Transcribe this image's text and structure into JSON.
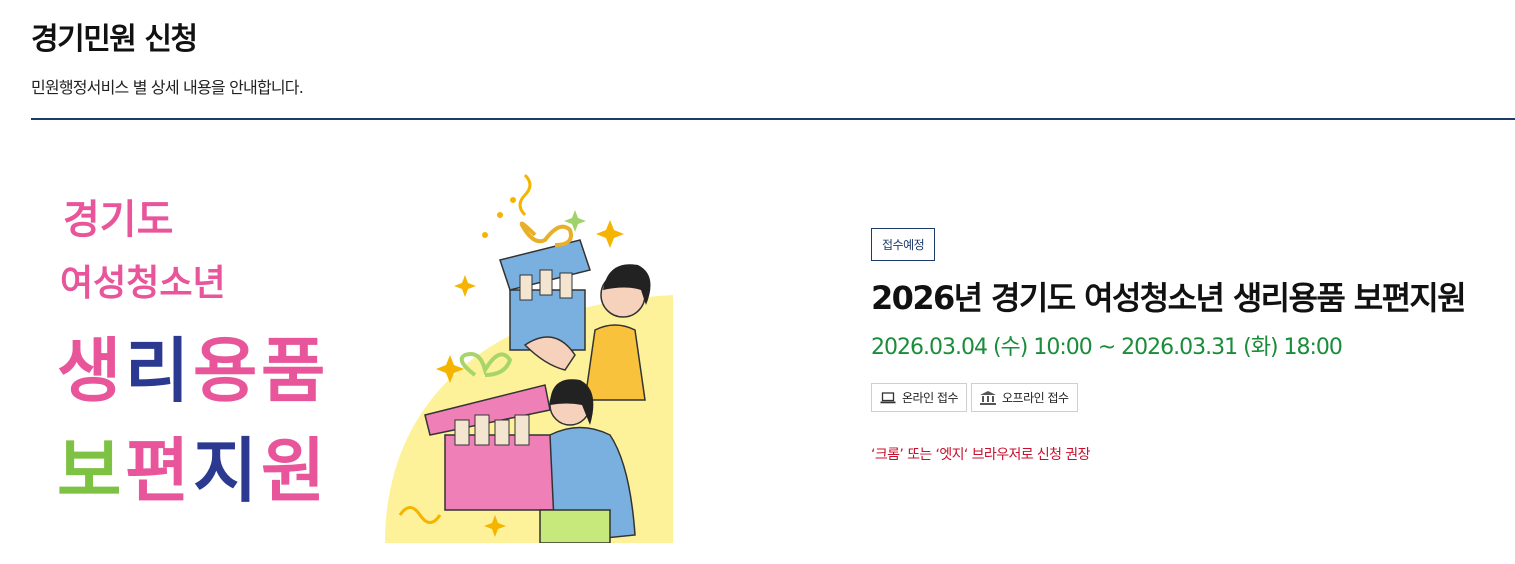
{
  "header": {
    "title": "경기민원 신청",
    "description": "민원행정서비스 별 상세 내용을 안내합니다."
  },
  "poster": {
    "line1": "경기도",
    "line2": "여성청소년",
    "line3": [
      "생",
      "리",
      "용",
      "품"
    ],
    "line4": [
      "보",
      "편",
      "지",
      "원"
    ],
    "colors": {
      "pink": "#e8559a",
      "navy": "#2b3990",
      "teal": "#1e9fb1",
      "green": "#7dc243",
      "yellow_bg": "#fdf29a"
    }
  },
  "service": {
    "status_badge": "접수예정",
    "title": "2026년 경기도 여성청소년 생리용품 보편지원",
    "period": "2026.03.04 (수) 10:00 ~ 2026.03.31 (화) 18:00",
    "methods": [
      {
        "icon": "laptop-icon",
        "label": "온라인 접수"
      },
      {
        "icon": "building-icon",
        "label": "오프라인 접수"
      }
    ],
    "notice": "‘크롬’ 또는 ‘엣지‘ 브라우저로 신청 권장"
  }
}
